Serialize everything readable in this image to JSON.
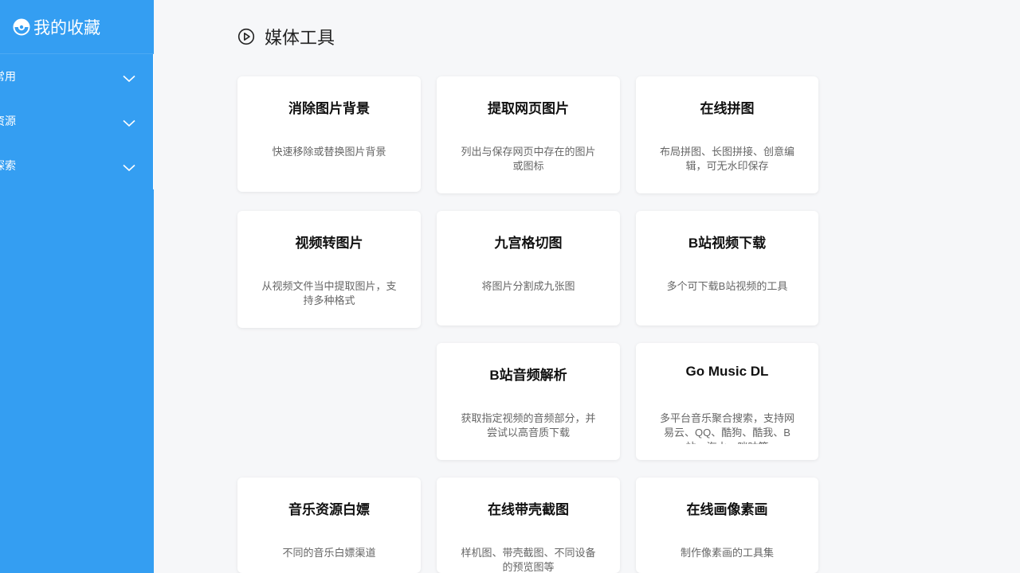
{
  "sidebar": {
    "title": "我的收藏",
    "items": [
      {
        "label": "常用"
      },
      {
        "label": "资源"
      },
      {
        "label": "探索"
      }
    ]
  },
  "main": {
    "section_title": "媒体工具",
    "cards": [
      {
        "title": "消除图片背景",
        "desc": "快速移除或替换图片背景"
      },
      {
        "title": "提取网页图片",
        "desc": "列出与保存网页中存在的图片或图标"
      },
      {
        "title": "在线拼图",
        "desc": "布局拼图、长图拼接、创意编辑，可无水印保存"
      },
      {
        "title": "视频转图片",
        "desc": "从视频文件当中提取图片，支持多种格式"
      },
      {
        "title": "九宫格切图",
        "desc": "将图片分割成九张图"
      },
      {
        "title": "B站视频下载",
        "desc": "多个可下载B站视频的工具"
      },
      {
        "title": "B站音频解析",
        "desc": "获取指定视频的音频部分，并尝试以高音质下载"
      },
      {
        "title": "Go Music DL",
        "desc": "多平台音乐聚合搜索，支持网易云、QQ、酷狗、酷我、B站、汽水、咪咕等"
      },
      {
        "title": "音乐资源白嫖",
        "desc": "不同的音乐白嫖渠道"
      },
      {
        "title": "在线带壳截图",
        "desc": "样机图、带壳截图、不同设备的预览图等"
      },
      {
        "title": "在线画像素画",
        "desc": "制作像素画的工具集"
      }
    ]
  },
  "colors": {
    "sidebar_bg": "#349ef2",
    "page_bg": "#f6f7f9",
    "card_bg": "#ffffff"
  },
  "icons": {
    "logo": "pokeball-icon",
    "section": "play-circle-icon",
    "nav_expand": "chevron-down-icon"
  }
}
